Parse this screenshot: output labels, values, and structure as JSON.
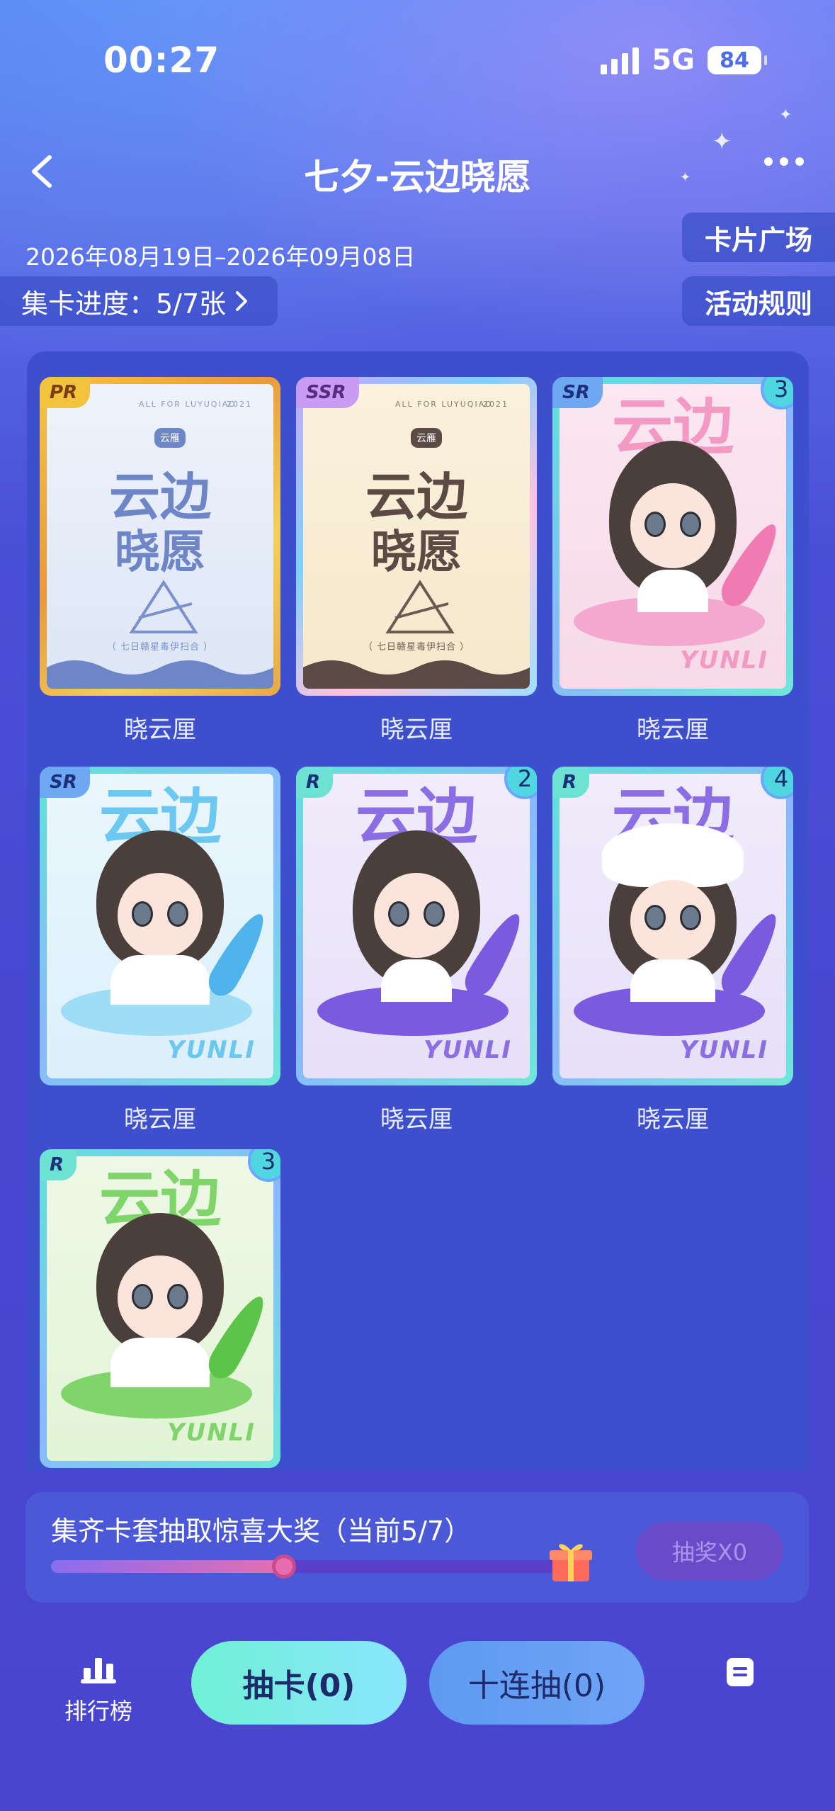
{
  "status_bar": {
    "time": "00:27",
    "network": "5G",
    "battery": "84"
  },
  "header": {
    "title": "七夕-云边晓愿",
    "date_range": "2026年08月19日–2026年09月08日",
    "progress_label": "集卡进度：5/7张",
    "card_plaza": "卡片广场",
    "rules": "活动规则"
  },
  "cards": [
    {
      "rarity": "PR",
      "name": "晓云厘",
      "count": "",
      "logo_line1": "云边",
      "logo_line2": "晓愿",
      "tag": "云雁",
      "top_left": "ALL FOR LUYUQIAO",
      "top_right": "2021",
      "footer": "（ 七日赣星毒伊扫合 ）",
      "theme": "blue"
    },
    {
      "rarity": "SSR",
      "name": "晓云厘",
      "count": "",
      "logo_line1": "云边",
      "logo_line2": "晓愿",
      "tag": "云雁",
      "top_left": "ALL FOR LUYUQIAO",
      "top_right": "2021",
      "footer": "（ 七日赣星毒伊扫合 ）",
      "theme": "cream"
    },
    {
      "rarity": "SR",
      "name": "晓云厘",
      "count": "3",
      "header": "云边",
      "brand": "YUNLI",
      "theme": "pink"
    },
    {
      "rarity": "SR",
      "name": "晓云厘",
      "count": "",
      "header": "云边",
      "brand": "YUNLI",
      "theme": "sky"
    },
    {
      "rarity": "R",
      "name": "晓云厘",
      "count": "2",
      "header": "云边",
      "brand": "YUNLI",
      "theme": "purple"
    },
    {
      "rarity": "R",
      "name": "晓云厘",
      "count": "4",
      "header": "云边",
      "brand": "YUNLI",
      "theme": "purple"
    },
    {
      "rarity": "R",
      "name": "",
      "count": "3",
      "header": "云边",
      "brand": "YUNLI",
      "theme": "green"
    }
  ],
  "reward": {
    "title": "集齐卡套抽取惊喜大奖（当前5/7）",
    "progress": 0.45,
    "draw_label": "抽奖X0"
  },
  "bottom_nav": {
    "rank_label": "排行榜",
    "pull_one": "抽卡(0)",
    "pull_ten": "十连抽(0)"
  },
  "colors": {
    "accent_teal": "#6ff0d4",
    "progress_pink": "#e86db0",
    "panel": "#3e4fce"
  }
}
